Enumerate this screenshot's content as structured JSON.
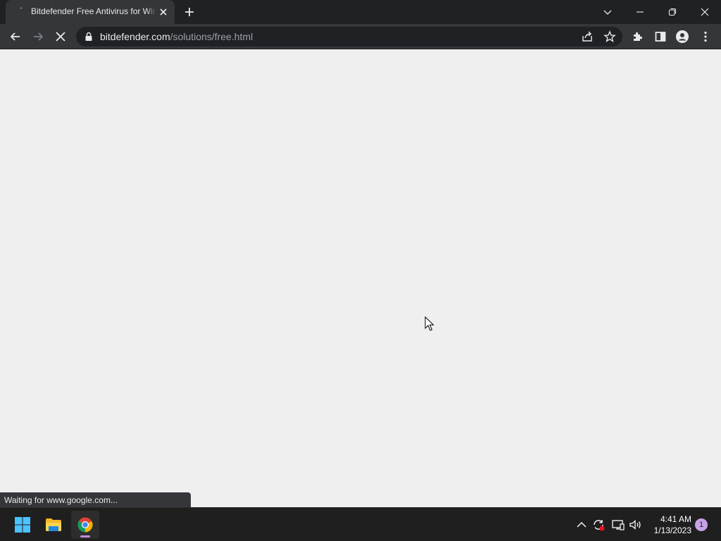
{
  "browser": {
    "tab": {
      "title": "Bitdefender Free Antivirus for Windows",
      "favicon": "loading-spinner-icon"
    },
    "address": {
      "host": "bitdefender.com",
      "path": "/solutions/free.html"
    },
    "status_text": "Waiting for www.google.com..."
  },
  "taskbar": {
    "apps": [
      "start-windows-icon",
      "file-explorer-icon",
      "chrome-icon"
    ],
    "clock": {
      "time": "4:41 AM",
      "date": "1/13/2023"
    },
    "notification_count": "1"
  },
  "colors": {
    "tabstrip": "#202124",
    "toolbar": "#35363a",
    "omnibox": "#202124",
    "page_background": "#efefef",
    "taskbar": "#1f1f1f",
    "active_indicator": "#c48bd9"
  }
}
